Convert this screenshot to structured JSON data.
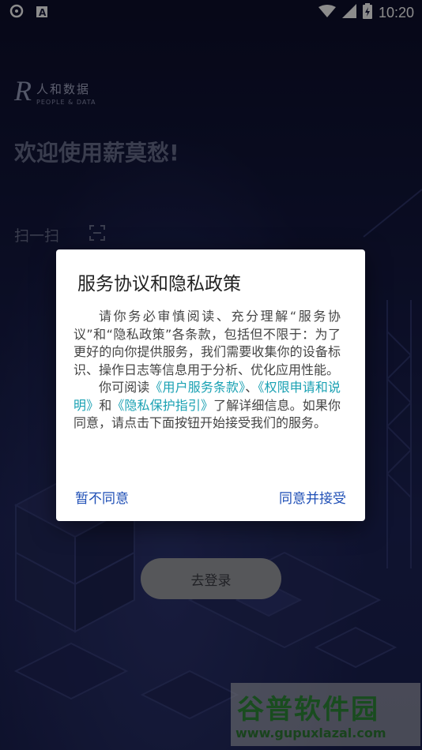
{
  "status_bar": {
    "time": "10:20",
    "icons": [
      "sync-icon",
      "notification-a-icon",
      "wifi-icon",
      "signal-icon",
      "battery-icon"
    ]
  },
  "logo": {
    "mark": "R",
    "chinese": "人和数据",
    "english": "PEOPLE & DATA"
  },
  "welcome_text": "欢迎使用薪莫愁!",
  "scan": {
    "label": "扫一扫",
    "icon": "scan-icon"
  },
  "login_button": "去登录",
  "dialog": {
    "title": "服务协议和隐私政策",
    "para1": "请你务必审慎阅读、充分理解“服务协议”和“隐私政策”各条款，包括但不限于：为了更好的向你提供服务，我们需要收集你的设备标识、操作日志等信息用于分析、优化应用性能。",
    "para2_prefix": "你可阅读",
    "link_terms": "《用户服务条款》",
    "sep1": "、",
    "link_permissions": "《权限申请和说明》",
    "sep2": "和",
    "link_privacy": "《隐私保护指引》",
    "para2_suffix": "了解详细信息。如果你同意，请点击下面按钮开始接受我们的服务。",
    "decline": "暂不同意",
    "accept": "同意并接受"
  },
  "watermark": {
    "chinese": "谷普软件园",
    "url": "www.gupuxlazal.com"
  },
  "colors": {
    "link": "#1aa1b3",
    "button_text": "#1f4fb6",
    "background": "#14163a"
  }
}
